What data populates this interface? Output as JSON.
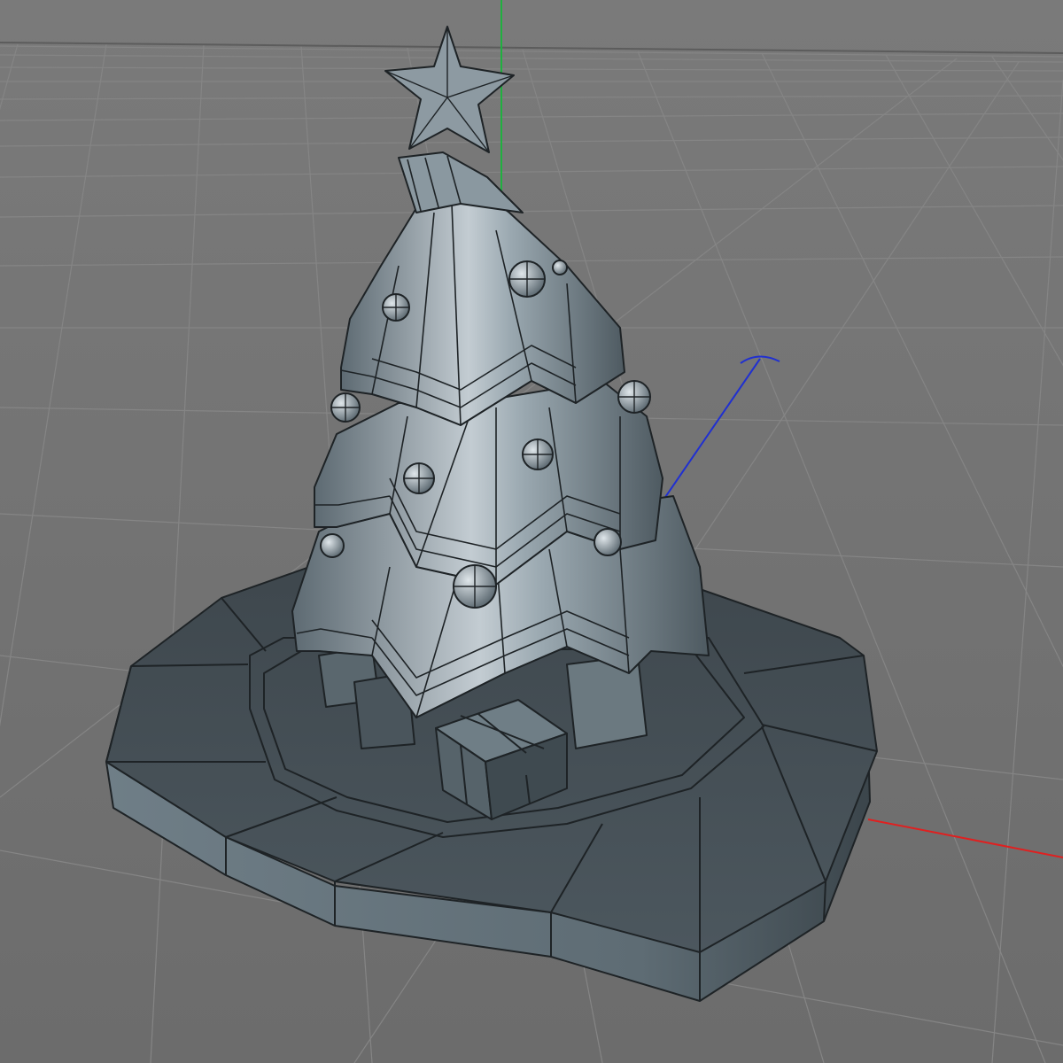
{
  "viewport": {
    "view": "perspective",
    "background_color": "#6f6f6f",
    "grid_line_color": "#8a8a8a",
    "horizon_color": "#5c5c5c"
  },
  "model": {
    "object": "christmas-tree",
    "display_mode": "gouraud-shaded-with-wireframe",
    "surface_color": "#7e8e98",
    "shadow_color": "#3f4a52",
    "highlight_color": "#c8d2d8",
    "edge_color": "#1e2326",
    "parts": [
      "star-topper",
      "tree-tiers",
      "ornaments",
      "gift-boxes",
      "octagonal-base"
    ]
  },
  "axes": {
    "x_axis_color": "#e02020",
    "y_axis_color": "#20b040",
    "z_axis_color": "#2030d0"
  }
}
